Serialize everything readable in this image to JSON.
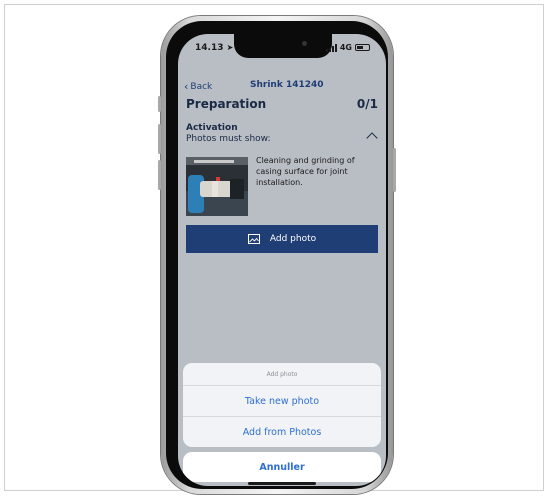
{
  "status_bar": {
    "time": "14.13",
    "network": "4G"
  },
  "nav": {
    "back_label": "Back",
    "title": "Shrink 141240"
  },
  "page": {
    "title": "Preparation",
    "count": "0/1"
  },
  "section": {
    "title": "Activation",
    "subtitle": "Photos must show:",
    "description": "Cleaning and grinding of casing surface for joint installation."
  },
  "add_photo_button": {
    "label": "Add photo"
  },
  "action_sheet": {
    "header": "Add photo",
    "options": [
      "Take new photo",
      "Add from Photos"
    ],
    "cancel_label": "Annuller"
  },
  "colors": {
    "brand_navy": "#1f3e75",
    "action_blue": "#2f6fd0",
    "dimmed_background": "#b9bec5"
  },
  "icons": [
    "back-chevron-icon",
    "location-arrow-icon",
    "signal-icon",
    "battery-icon",
    "collapse-chevron-icon",
    "image-icon"
  ]
}
